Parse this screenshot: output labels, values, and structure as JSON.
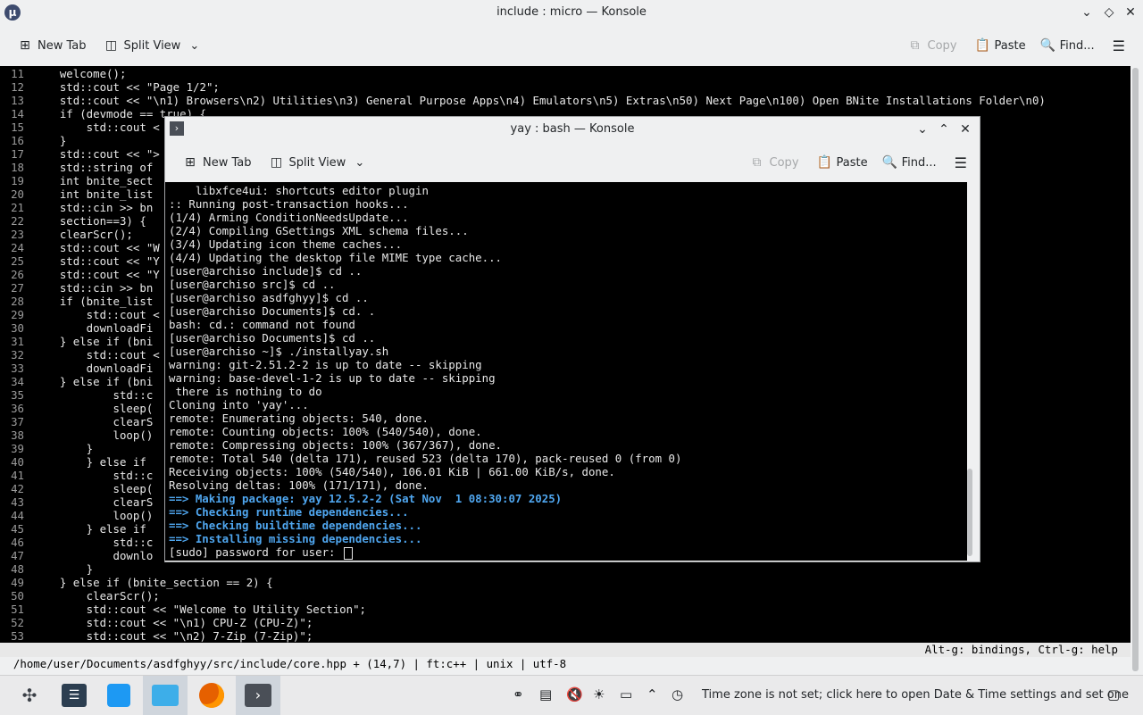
{
  "outer": {
    "title": "include : micro — Konsole",
    "app_icon": "μ",
    "toolbar": {
      "new_tab": "New Tab",
      "split_view": "Split View",
      "copy": "Copy",
      "paste": "Paste",
      "find": "Find..."
    }
  },
  "editor": {
    "lines": [
      {
        "n": "11",
        "t": "    welcome();"
      },
      {
        "n": "12",
        "t": "    std::cout << \"Page 1/2\";"
      },
      {
        "n": "13",
        "t": "    std::cout << \"\\n1) Browsers\\n2) Utilities\\n3) General Purpose Apps\\n4) Emulators\\n5) Extras\\n50) Next Page\\n100) Open BNite Installations Folder\\n0)"
      },
      {
        "n": "14",
        "t": "    if (devmode == true) {"
      },
      {
        "n": "15",
        "t": "        std::cout <"
      },
      {
        "n": "16",
        "t": "    }"
      },
      {
        "n": "17",
        "t": "    std::cout << \">"
      },
      {
        "n": "18",
        "t": "    std::string of"
      },
      {
        "n": "19",
        "t": "    int bnite_sect"
      },
      {
        "n": "20",
        "t": "    int bnite_list"
      },
      {
        "n": "21",
        "t": "    std::cin >> bn"
      },
      {
        "n": "22",
        "t": "    section==3) {"
      },
      {
        "n": "23",
        "t": "    clearScr();"
      },
      {
        "n": "24",
        "t": "    std::cout << \"W"
      },
      {
        "n": "25",
        "t": "    std::cout << \"Y"
      },
      {
        "n": "26",
        "t": "    std::cout << \"Y"
      },
      {
        "n": "27",
        "t": "    std::cin >> bn"
      },
      {
        "n": "28",
        "t": "    if (bnite_list"
      },
      {
        "n": "29",
        "t": "        std::cout <"
      },
      {
        "n": "30",
        "t": "        downloadFi"
      },
      {
        "n": "31",
        "t": "    } else if (bni"
      },
      {
        "n": "32",
        "t": "        std::cout <"
      },
      {
        "n": "33",
        "t": "        downloadFi"
      },
      {
        "n": "34",
        "t": "    } else if (bni"
      },
      {
        "n": "35",
        "t": "            std::c"
      },
      {
        "n": "36",
        "t": "            sleep("
      },
      {
        "n": "37",
        "t": "            clearS"
      },
      {
        "n": "38",
        "t": "            loop()"
      },
      {
        "n": "39",
        "t": "        }"
      },
      {
        "n": "40",
        "t": "        } else if"
      },
      {
        "n": "41",
        "t": "            std::c"
      },
      {
        "n": "42",
        "t": "            sleep("
      },
      {
        "n": "43",
        "t": "            clearS"
      },
      {
        "n": "44",
        "t": "            loop()"
      },
      {
        "n": "45",
        "t": "        } else if"
      },
      {
        "n": "46",
        "t": "            std::c"
      },
      {
        "n": "47",
        "t": "            downlo"
      },
      {
        "n": "48",
        "t": "        }"
      },
      {
        "n": "49",
        "t": "    } else if (bnite_section == 2) {"
      },
      {
        "n": "50",
        "t": "        clearScr();"
      },
      {
        "n": "51",
        "t": "        std::cout << \"Welcome to Utility Section\";"
      },
      {
        "n": "52",
        "t": "        std::cout << \"\\n1) CPU-Z (CPU-Z)\";"
      },
      {
        "n": "53",
        "t": "        std::cout << \"\\n2) 7-Zip (7-Zip)\";"
      }
    ],
    "status_left": "/home/user/Documents/asdfghyy/src/include/core.hpp + (14,7) | ft:c++ | unix | utf-8",
    "status_right": "Alt-g: bindings, Ctrl-g: help"
  },
  "inner": {
    "title": "yay : bash — Konsole",
    "toolbar": {
      "new_tab": "New Tab",
      "split_view": "Split View",
      "copy": "Copy",
      "paste": "Paste",
      "find": "Find..."
    },
    "lines": [
      {
        "t": "    libxfce4ui: shortcuts editor plugin",
        "c": ""
      },
      {
        "t": ":: Running post-transaction hooks...",
        "c": ""
      },
      {
        "t": "(1/4) Arming ConditionNeedsUpdate...",
        "c": ""
      },
      {
        "t": "(2/4) Compiling GSettings XML schema files...",
        "c": ""
      },
      {
        "t": "(3/4) Updating icon theme caches...",
        "c": ""
      },
      {
        "t": "(4/4) Updating the desktop file MIME type cache...",
        "c": ""
      },
      {
        "t": "[user@archiso include]$ cd ..",
        "c": ""
      },
      {
        "t": "[user@archiso src]$ cd ..",
        "c": ""
      },
      {
        "t": "[user@archiso asdfghyy]$ cd ..",
        "c": ""
      },
      {
        "t": "[user@archiso Documents]$ cd. .",
        "c": ""
      },
      {
        "t": "bash: cd.: command not found",
        "c": ""
      },
      {
        "t": "[user@archiso Documents]$ cd ..",
        "c": ""
      },
      {
        "t": "[user@archiso ~]$ ./installyay.sh",
        "c": ""
      },
      {
        "t": "warning: git-2.51.2-2 is up to date -- skipping",
        "c": ""
      },
      {
        "t": "warning: base-devel-1-2 is up to date -- skipping",
        "c": ""
      },
      {
        "t": " there is nothing to do",
        "c": ""
      },
      {
        "t": "Cloning into 'yay'...",
        "c": ""
      },
      {
        "t": "remote: Enumerating objects: 540, done.",
        "c": ""
      },
      {
        "t": "remote: Counting objects: 100% (540/540), done.",
        "c": ""
      },
      {
        "t": "remote: Compressing objects: 100% (367/367), done.",
        "c": ""
      },
      {
        "t": "remote: Total 540 (delta 171), reused 523 (delta 170), pack-reused 0 (from 0)",
        "c": ""
      },
      {
        "t": "Receiving objects: 100% (540/540), 106.01 KiB | 661.00 KiB/s, done.",
        "c": ""
      },
      {
        "t": "Resolving deltas: 100% (171/171), done.",
        "c": ""
      },
      {
        "t": "==> Making package: yay 12.5.2-2 (Sat Nov  1 08:30:07 2025)",
        "c": "blue"
      },
      {
        "t": "==> Checking runtime dependencies...",
        "c": "blue"
      },
      {
        "t": "==> Checking buildtime dependencies...",
        "c": "blue"
      },
      {
        "t": "==> Installing missing dependencies...",
        "c": "blue"
      },
      {
        "t": "[sudo] password for user: ",
        "c": "cursor"
      }
    ]
  },
  "taskbar": {
    "clock_message": "Time zone is not set; click here to open Date & Time settings and set one",
    "icons": [
      "app-launcher-icon",
      "system-settings-icon",
      "discover-icon",
      "file-manager-icon",
      "firefox-icon",
      "konsole-icon"
    ]
  },
  "colors": {
    "accent_blue": "#4fa6ef",
    "string_yellow": "#e5b567",
    "keyword_red": "#e24b4b"
  }
}
